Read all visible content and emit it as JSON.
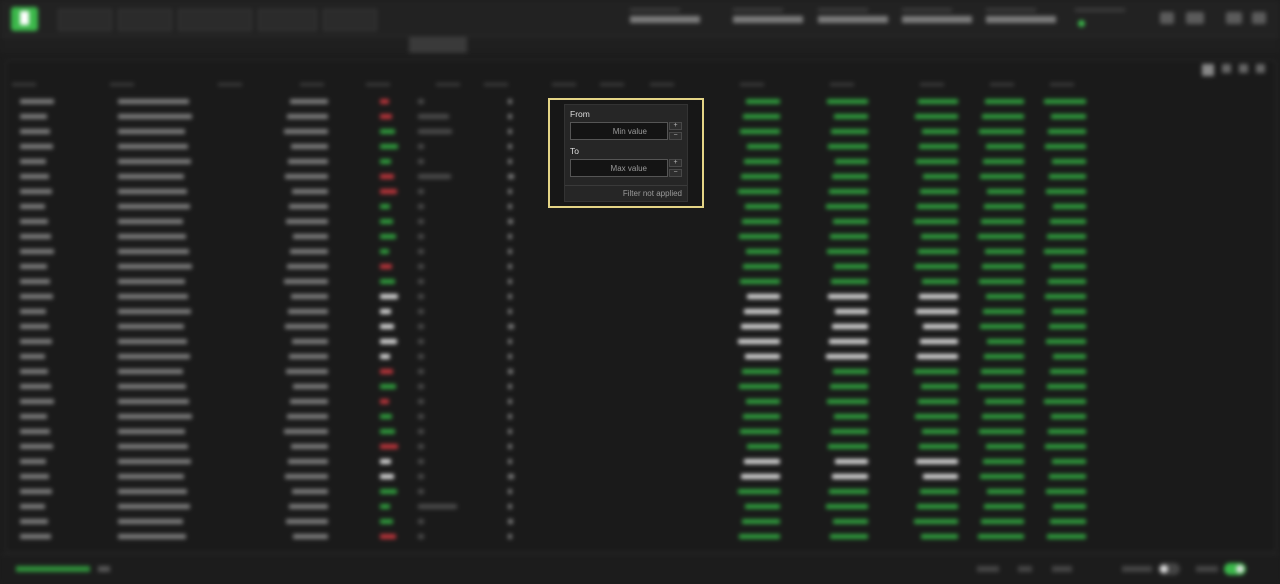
{
  "filter_popup": {
    "from_label": "From",
    "from_placeholder": "Min value",
    "to_label": "To",
    "to_placeholder": "Max value",
    "status": "Filter not applied",
    "increment_glyph": "+",
    "decrement_glyph": "−"
  },
  "colors": {
    "accent_green": "#3bb84a",
    "positive": "#2f9b3c",
    "negative": "#b8343a",
    "highlight_border": "#e4d486",
    "popup_bg": "#262626"
  },
  "icons": {
    "logo": "app-logo-icon",
    "stepper_up": "plus-icon",
    "stepper_down": "minus-icon"
  }
}
